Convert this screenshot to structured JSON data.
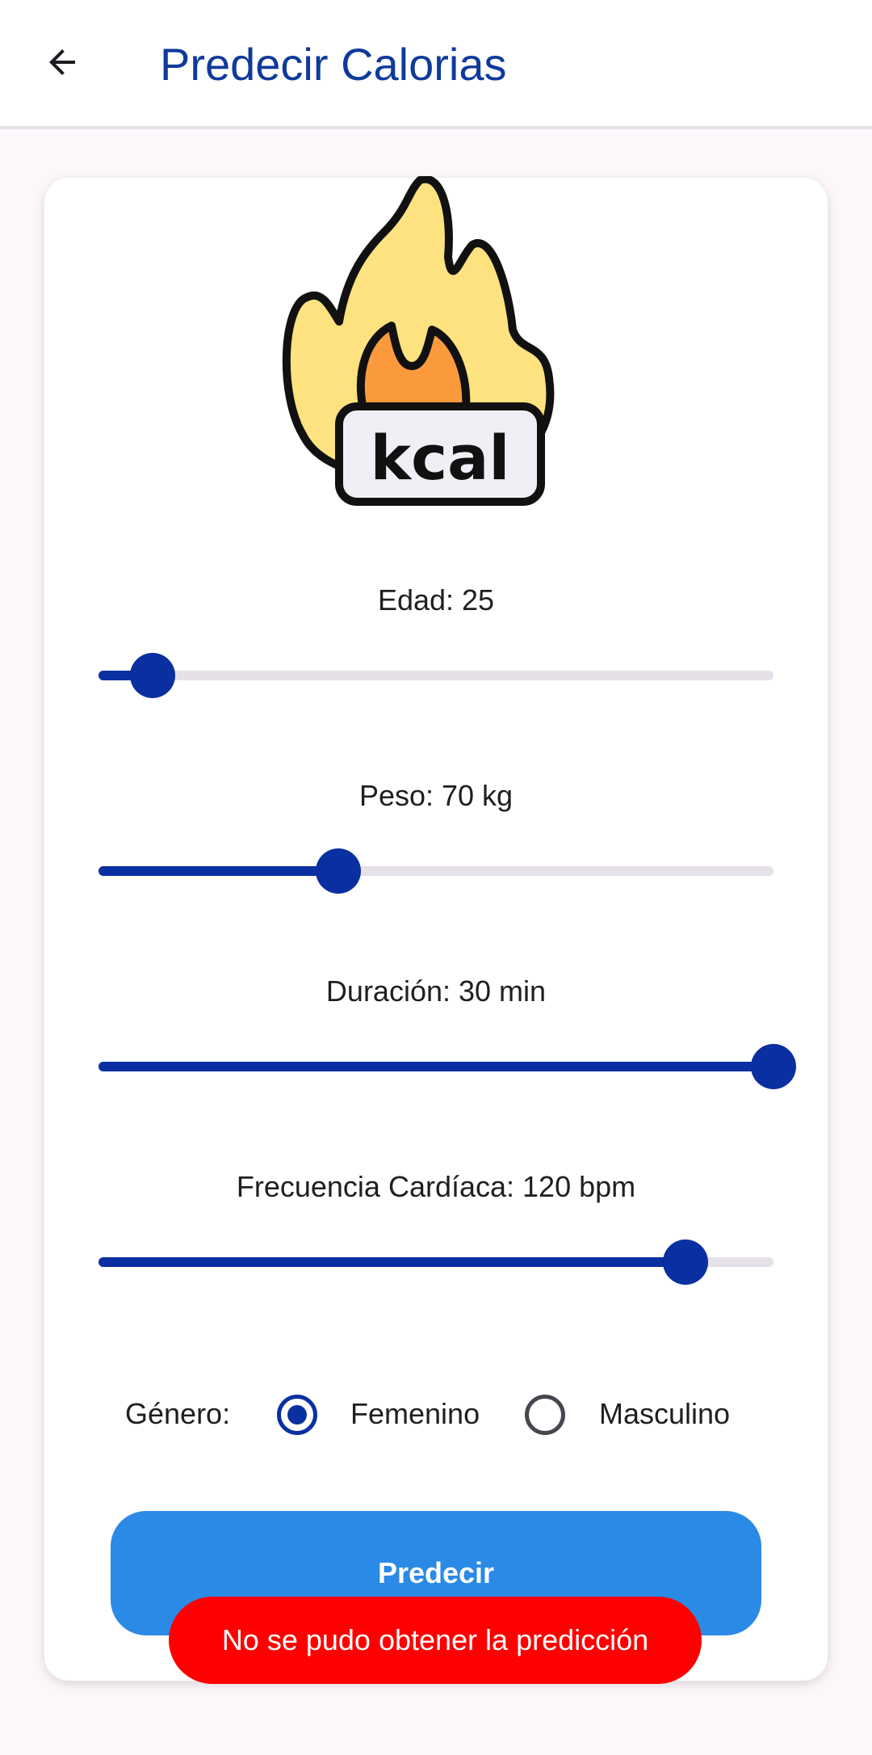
{
  "appbar": {
    "title": "Predecir Calorias",
    "back_icon": "arrow-left-icon",
    "title_color": "#0f3a9c"
  },
  "logo": {
    "icon": "fire-kcal-icon",
    "text": "kcal"
  },
  "sliders": [
    {
      "label": "Edad: 25",
      "value_fraction": 0.08
    },
    {
      "label": "Peso: 70 kg",
      "value_fraction": 0.355
    },
    {
      "label": "Duración: 30 min",
      "value_fraction": 1.0
    },
    {
      "label": "Frecuencia Cardíaca: 120 bpm",
      "value_fraction": 0.87
    }
  ],
  "gender": {
    "label": "Género:",
    "options": [
      {
        "label": "Femenino",
        "selected": true
      },
      {
        "label": "Masculino",
        "selected": false
      }
    ]
  },
  "predict_button": {
    "label": "Predecir",
    "color": "#2a8ae6"
  },
  "toast": {
    "message": "No se pudo obtener la predicción",
    "color": "#ff0000"
  },
  "colors": {
    "accent": "#0a2fa0",
    "track": "#e6e0e9",
    "background": "#fdf7fb"
  }
}
